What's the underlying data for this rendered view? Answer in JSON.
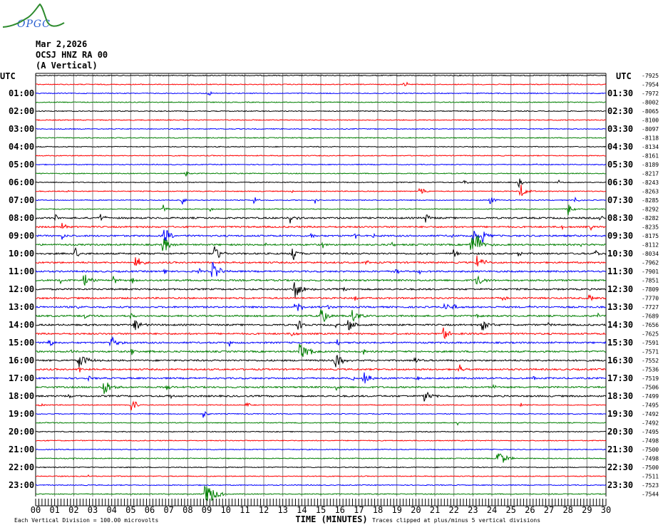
{
  "logo": {
    "text": "OPGC",
    "curve_color": "#2e8b2e",
    "text_color": "#2a5fd0"
  },
  "header": {
    "date": "Mar 2,2026",
    "station": "OCSJ HNZ RA 00",
    "component": "(A Vertical)"
  },
  "chart_data": {
    "type": "line",
    "subtype": "helicorder",
    "title": "Mar 2,2026 OCSJ HNZ RA 00 (A Vertical)",
    "xlabel": "TIME (MINUTES)",
    "xlim": [
      0,
      30
    ],
    "x_ticks": [
      "00",
      "01",
      "02",
      "03",
      "04",
      "05",
      "06",
      "07",
      "08",
      "09",
      "10",
      "11",
      "12",
      "13",
      "14",
      "15",
      "16",
      "17",
      "18",
      "19",
      "20",
      "21",
      "22",
      "23",
      "24",
      "25",
      "26",
      "27",
      "28",
      "29",
      "30"
    ],
    "left_header": "UTC",
    "right_header": "UTC",
    "left_labels": [
      "01:00",
      "02:00",
      "03:00",
      "04:00",
      "05:00",
      "06:00",
      "07:00",
      "08:00",
      "09:00",
      "10:00",
      "11:00",
      "12:00",
      "13:00",
      "14:00",
      "15:00",
      "16:00",
      "17:00",
      "18:00",
      "19:00",
      "20:00",
      "21:00",
      "22:00",
      "23:00"
    ],
    "right_labels": [
      "01:30",
      "02:30",
      "03:30",
      "04:30",
      "05:30",
      "06:30",
      "07:30",
      "08:30",
      "09:30",
      "10:30",
      "11:30",
      "12:30",
      "13:30",
      "14:30",
      "15:30",
      "16:30",
      "17:30",
      "18:30",
      "19:30",
      "20:30",
      "21:30",
      "22:30",
      "23:30"
    ],
    "row_offsets": [
      "-7925",
      "-7954",
      "-7972",
      "-8002",
      "-8065",
      "-8100",
      "-8097",
      "-8118",
      "-8134",
      "-8161",
      "-8189",
      "-8217",
      "-8243",
      "-8263",
      "-8285",
      "-8292",
      "-8282",
      "-8235",
      "-8175",
      "-8112",
      "-8034",
      "-7962",
      "-7901",
      "-7851",
      "-7809",
      "-7770",
      "-7727",
      "-7689",
      "-7656",
      "-7625",
      "-7591",
      "-7571",
      "-7552",
      "-7536",
      "-7519",
      "-7506",
      "-7499",
      "-7495",
      "-7492",
      "-7492",
      "-7495",
      "-7498",
      "-7500",
      "-7498",
      "-7500",
      "-7511",
      "-7523",
      "-7544"
    ],
    "trace_colors": [
      "#000000",
      "#ff0000",
      "#0000ff",
      "#007f00"
    ],
    "grid_color": "#808080",
    "rows": 48,
    "minutes_per_row": 30,
    "events": [
      [
        1,
        19.4,
        8
      ],
      [
        2,
        9.1,
        6
      ],
      [
        10,
        26.4,
        3
      ],
      [
        11,
        7.9,
        6
      ],
      [
        12,
        22.5,
        8
      ],
      [
        12,
        25.4,
        8
      ],
      [
        12,
        27.5,
        4
      ],
      [
        13,
        1.7,
        3
      ],
      [
        13,
        13.5,
        3
      ],
      [
        13,
        20.2,
        10
      ],
      [
        13,
        25.5,
        12
      ],
      [
        14,
        7.7,
        7
      ],
      [
        14,
        11.5,
        7
      ],
      [
        14,
        14.7,
        5
      ],
      [
        14,
        23.9,
        8
      ],
      [
        14,
        28.4,
        6
      ],
      [
        15,
        6.7,
        8
      ],
      [
        15,
        9.2,
        4
      ],
      [
        15,
        28.0,
        10
      ],
      [
        16,
        1.05,
        6
      ],
      [
        16,
        3.4,
        8
      ],
      [
        16,
        13.4,
        10
      ],
      [
        16,
        20.5,
        8
      ],
      [
        16,
        29.7,
        8
      ],
      [
        17,
        1.4,
        10
      ],
      [
        17,
        27.7,
        4
      ],
      [
        17,
        29.2,
        4
      ],
      [
        18,
        1.4,
        6
      ],
      [
        18,
        6.75,
        14
      ],
      [
        18,
        14.5,
        8
      ],
      [
        18,
        16.8,
        6
      ],
      [
        18,
        17.8,
        5
      ],
      [
        18,
        21.9,
        5
      ],
      [
        18,
        23.0,
        10
      ],
      [
        18,
        23.5,
        12
      ],
      [
        19,
        6.7,
        14
      ],
      [
        19,
        12.1,
        5
      ],
      [
        19,
        15.1,
        5
      ],
      [
        19,
        18.75,
        6
      ],
      [
        19,
        22.9,
        16
      ],
      [
        19,
        23.2,
        14
      ],
      [
        19,
        28.7,
        5
      ],
      [
        20,
        2.06,
        10
      ],
      [
        20,
        9.4,
        14
      ],
      [
        20,
        13.5,
        12
      ],
      [
        20,
        20.4,
        5
      ],
      [
        20,
        22.0,
        8
      ],
      [
        20,
        25.4,
        6
      ],
      [
        20,
        29.4,
        8
      ],
      [
        21,
        5.25,
        12
      ],
      [
        21,
        17.4,
        5
      ],
      [
        21,
        23.2,
        14
      ],
      [
        22,
        6.8,
        6
      ],
      [
        22,
        8.6,
        5
      ],
      [
        22,
        9.3,
        16
      ],
      [
        22,
        18.9,
        8
      ],
      [
        22,
        20.2,
        5
      ],
      [
        23,
        1.3,
        5
      ],
      [
        23,
        2.55,
        12
      ],
      [
        23,
        4.1,
        8
      ],
      [
        23,
        5.1,
        6
      ],
      [
        23,
        23.2,
        12
      ],
      [
        24,
        13.6,
        16
      ],
      [
        24,
        16.2,
        6
      ],
      [
        25,
        16.8,
        5
      ],
      [
        25,
        24.6,
        5
      ],
      [
        25,
        29.1,
        8
      ],
      [
        26,
        2.2,
        5
      ],
      [
        26,
        13.6,
        14
      ],
      [
        26,
        15.4,
        6
      ],
      [
        26,
        21.5,
        8
      ],
      [
        26,
        22.0,
        6
      ],
      [
        26,
        26.0,
        5
      ],
      [
        27,
        2.6,
        5
      ],
      [
        27,
        5.0,
        6
      ],
      [
        27,
        15.0,
        14
      ],
      [
        27,
        16.65,
        14
      ],
      [
        27,
        23.2,
        6
      ],
      [
        27,
        29.6,
        5
      ],
      [
        28,
        5.2,
        12
      ],
      [
        28,
        13.8,
        10
      ],
      [
        28,
        15.8,
        6
      ],
      [
        28,
        16.45,
        12
      ],
      [
        28,
        23.5,
        12
      ],
      [
        28,
        27.0,
        5
      ],
      [
        29,
        13.5,
        6
      ],
      [
        29,
        21.45,
        12
      ],
      [
        30,
        0.7,
        8
      ],
      [
        30,
        3.95,
        12
      ],
      [
        30,
        10.2,
        5
      ],
      [
        30,
        15.85,
        6
      ],
      [
        31,
        1.9,
        5
      ],
      [
        31,
        5.05,
        6
      ],
      [
        31,
        6.0,
        5
      ],
      [
        31,
        13.9,
        16
      ],
      [
        31,
        14.5,
        6
      ],
      [
        31,
        17.25,
        5
      ],
      [
        32,
        2.25,
        16
      ],
      [
        32,
        15.75,
        14
      ],
      [
        32,
        19.9,
        8
      ],
      [
        33,
        2.3,
        6
      ],
      [
        33,
        22.3,
        8
      ],
      [
        34,
        2.8,
        5
      ],
      [
        34,
        16.6,
        6
      ],
      [
        34,
        17.25,
        12
      ],
      [
        34,
        20.1,
        5
      ],
      [
        34,
        26.2,
        5
      ],
      [
        35,
        3.55,
        16
      ],
      [
        35,
        6.9,
        6
      ],
      [
        35,
        15.8,
        6
      ],
      [
        35,
        24.1,
        6
      ],
      [
        36,
        1.75,
        5
      ],
      [
        36,
        7.05,
        6
      ],
      [
        36,
        20.45,
        12
      ],
      [
        37,
        0.25,
        5
      ],
      [
        37,
        5.0,
        10
      ],
      [
        37,
        5.25,
        6
      ],
      [
        37,
        11.1,
        6
      ],
      [
        37,
        25.5,
        5
      ],
      [
        38,
        8.8,
        8
      ],
      [
        39,
        22.2,
        4
      ],
      [
        43,
        2.0,
        3
      ],
      [
        43,
        24.3,
        16
      ],
      [
        45,
        2.8,
        3
      ],
      [
        47,
        8.9,
        22
      ]
    ]
  },
  "footer": {
    "scale_note": "Each Vertical Division =  100.00 microvolts",
    "clip_note": "Traces clipped at plus/minus 5 vertical divisions"
  }
}
